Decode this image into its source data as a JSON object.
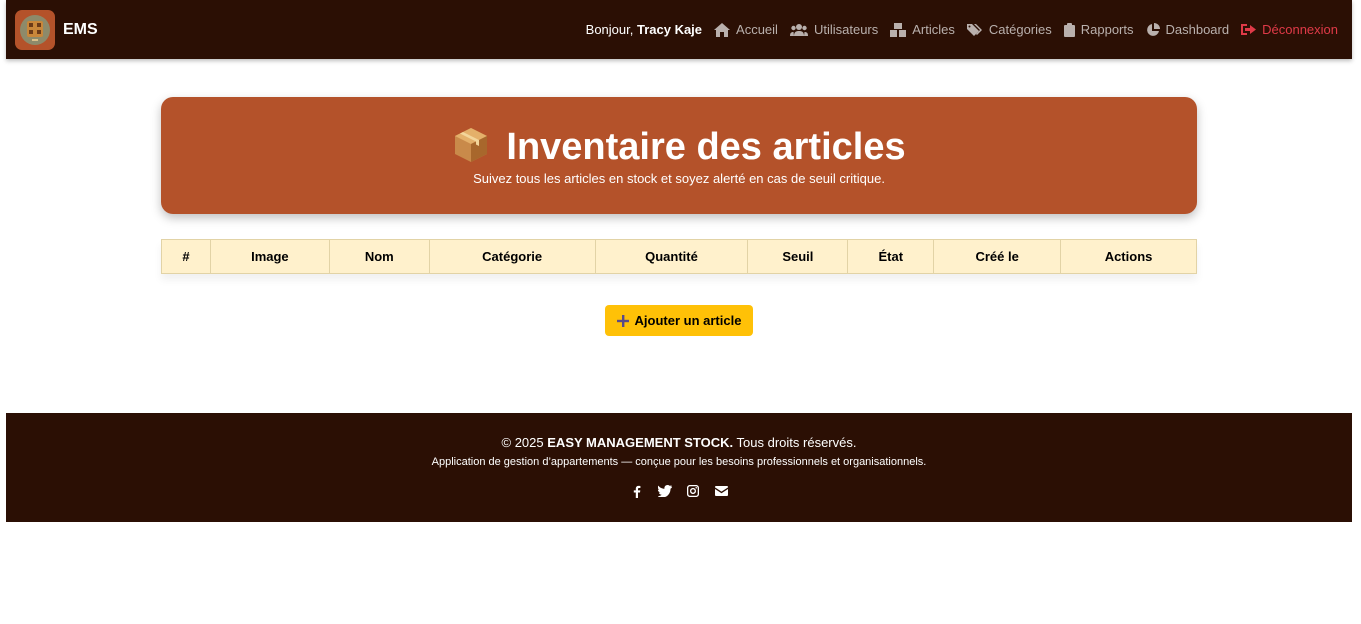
{
  "navbar": {
    "brand": "EMS",
    "greeting_prefix": "Bonjour,",
    "user_name": "Tracy Kaje",
    "links": [
      {
        "label": "Accueil",
        "icon": "home-icon"
      },
      {
        "label": "Utilisateurs",
        "icon": "users-icon"
      },
      {
        "label": "Articles",
        "icon": "boxes-icon"
      },
      {
        "label": "Catégories",
        "icon": "tags-icon"
      },
      {
        "label": "Rapports",
        "icon": "clipboard-icon"
      },
      {
        "label": "Dashboard",
        "icon": "pie-chart-icon"
      }
    ],
    "logout": {
      "label": "Déconnexion",
      "icon": "logout-icon",
      "color": "#e03a48"
    }
  },
  "hero": {
    "emoji": "📦",
    "title": "Inventaire des articles",
    "subtitle": "Suivez tous les articles en stock et soyez alerté en cas de seuil critique.",
    "background": "#b4522a"
  },
  "table": {
    "columns": [
      "#",
      "Image",
      "Nom",
      "Catégorie",
      "Quantité",
      "Seuil",
      "État",
      "Créé le",
      "Actions"
    ],
    "rows": []
  },
  "add_button": {
    "label": "Ajouter un article",
    "icon": "plus-icon",
    "color": "#ffc107"
  },
  "footer": {
    "copyright_prefix": "© 2025",
    "company": "EASY MANAGEMENT STOCK.",
    "rights": "Tous droits réservés.",
    "description": "Application de gestion d’appartements — conçue pour les besoins professionnels et organisationnels.",
    "social": [
      "facebook-icon",
      "twitter-icon",
      "instagram-icon",
      "envelope-icon"
    ]
  },
  "colors": {
    "dark": "#2b0f04",
    "accent": "#b4522a",
    "table_header": "#fff1cc"
  }
}
